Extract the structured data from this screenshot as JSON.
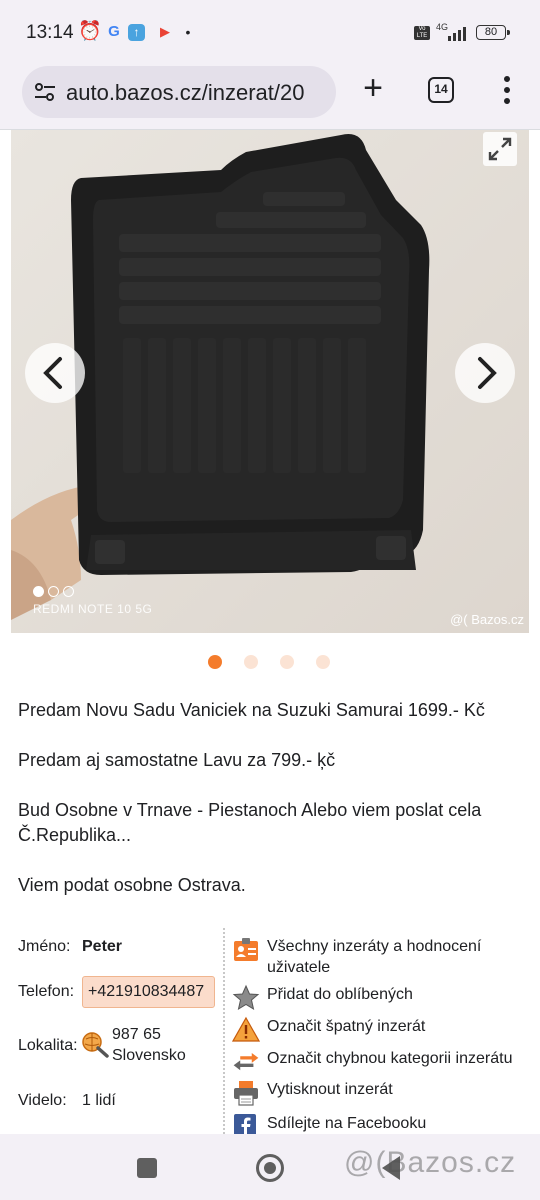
{
  "status": {
    "time": "13:14",
    "network": "4G",
    "battery": "80",
    "icons": [
      "alarm-icon",
      "google-icon",
      "upload-icon",
      "play-icon",
      "dot-icon"
    ]
  },
  "browser": {
    "url": "auto.bazos.cz/inzerat/20",
    "tab_count": "14"
  },
  "gallery": {
    "device_watermark": "REDMI NOTE 10 5G",
    "site_watermark": "@( Bazos.cz",
    "image_count": 4,
    "active_index": 0
  },
  "description": {
    "lines": [
      "Predam Novu Sadu Vaniciek na Suzuki Samurai 1699.- Kč",
      "Predam aj samostatne Lavu za 799.- ķč",
      "Bud Osobne v Trnave - Piestanoch Alebo viem poslat cela Č.Republika...",
      "Viem podat osobne Ostrava."
    ]
  },
  "details": {
    "name_label": "Jméno:",
    "name_value": "Peter",
    "phone_label": "Telefon:",
    "phone_value": "+421910834487",
    "location_label": "Lokalita:",
    "location_zip": "987 65",
    "location_country": "Slovensko",
    "views_label": "Videlo:",
    "views_value": "1 lidí"
  },
  "actions": [
    {
      "label": "Všechny inzeráty a hodnocení uživatele",
      "icon": "user-card-icon"
    },
    {
      "label": "Přidat do oblíbených",
      "icon": "star-icon"
    },
    {
      "label": "Označit špatný inzerát",
      "icon": "warning-icon"
    },
    {
      "label": "Označit chybnou kategorii inzerátu",
      "icon": "swap-arrows-icon"
    },
    {
      "label": "Vytisknout inzerát",
      "icon": "printer-icon"
    },
    {
      "label": "Sdílejte na Facebooku",
      "icon": "facebook-icon"
    }
  ],
  "navbar": {
    "watermark": "@(Bazos.cz"
  },
  "colors": {
    "accent": "#f47c2c",
    "phone_bg": "#fbdccb",
    "facebook": "#3b5998"
  }
}
